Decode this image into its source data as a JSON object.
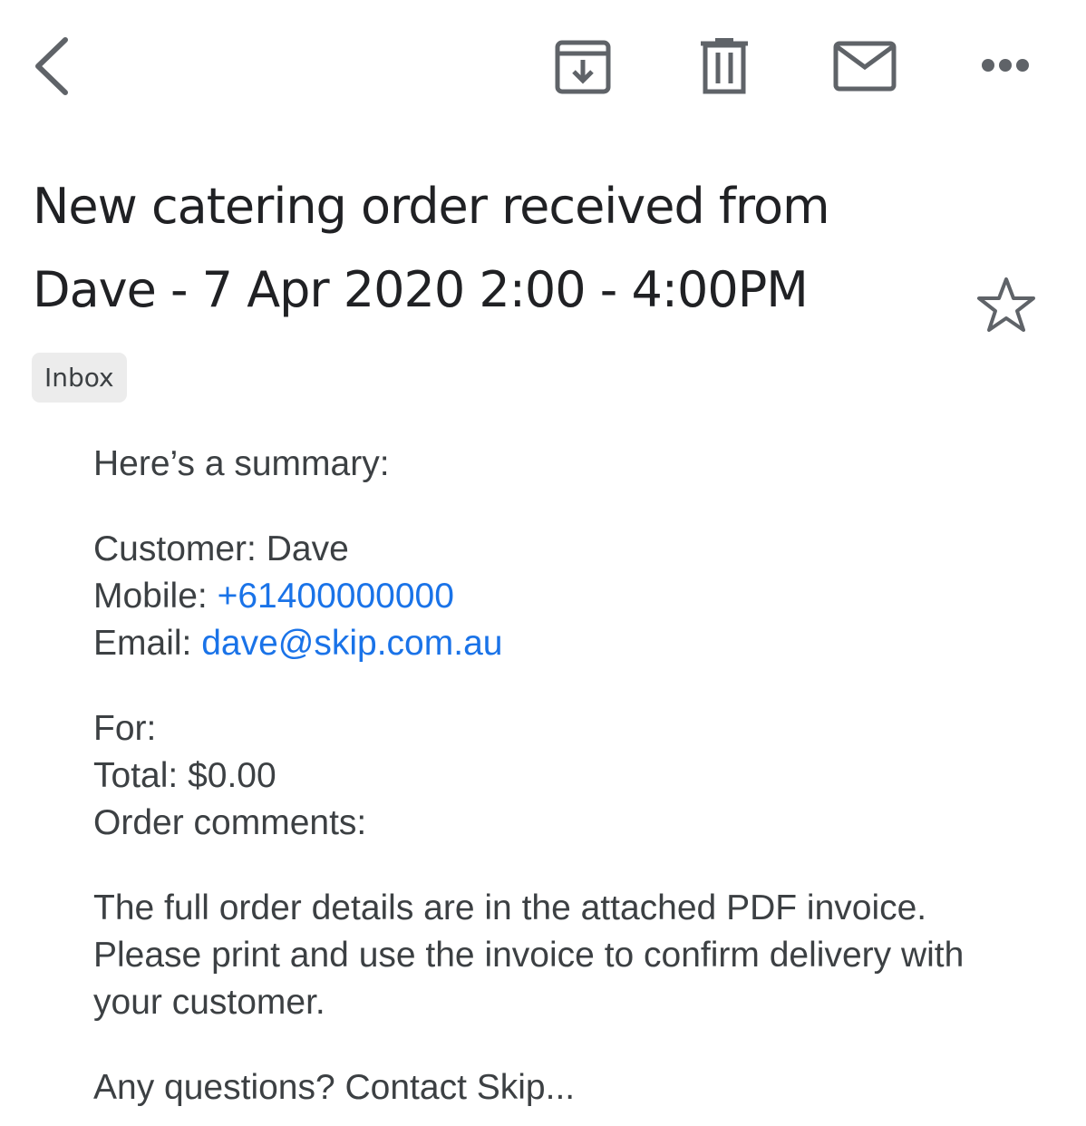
{
  "toolbar": {
    "back": "back-icon",
    "archive": "archive-icon",
    "delete": "trash-icon",
    "mark_unread": "mail-icon",
    "more": "more-horizontal-icon",
    "icon_color": "#5f6368"
  },
  "email": {
    "subject": "New catering order received from Dave - 7 Apr 2020 2:00 - 4:00PM",
    "label": "Inbox",
    "starred": false,
    "body": {
      "intro": "Here’s a summary:",
      "customer_label": "Customer: ",
      "customer_value": "Dave",
      "mobile_label": "Mobile: ",
      "mobile_value": "+61400000000",
      "email_label": "Email: ",
      "email_value": "dave@skip.com.au",
      "for_label": "For:",
      "total_label": "Total: ",
      "total_value": "$0.00",
      "comments_label": "Order comments:",
      "details": "The full order details are in the attached PDF invoice. Please print and use the invoice to confirm delivery with your customer.",
      "closing": "Any questions? Contact Skip..."
    }
  },
  "colors": {
    "link": "#1a73e8",
    "text": "#3c4043",
    "chip_bg": "#ececec"
  }
}
